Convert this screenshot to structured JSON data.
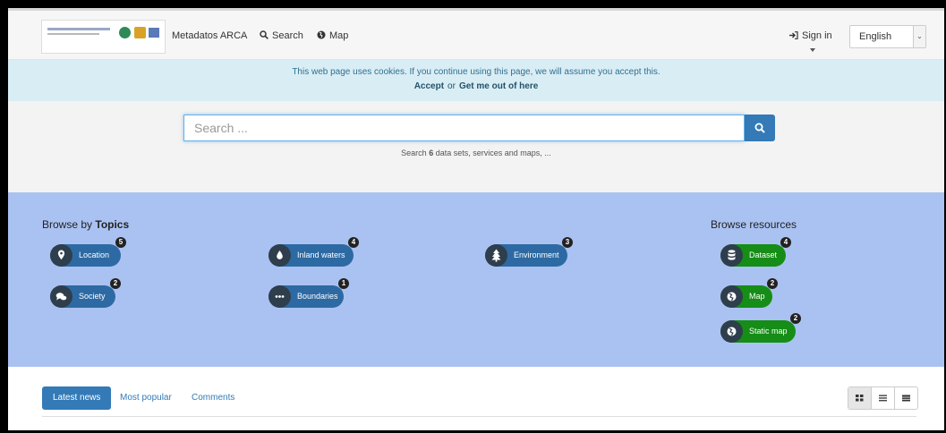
{
  "navbar": {
    "brand": "Metadatos ARCA",
    "search_label": "Search",
    "map_label": "Map",
    "signin_label": "Sign in",
    "language": "English"
  },
  "cookie": {
    "message": "This web page uses cookies. If you continue using this page, we will assume you accept this.",
    "accept_label": "Accept",
    "or_label": "or",
    "decline_label": "Get me out of here"
  },
  "search": {
    "placeholder": "Search ...",
    "hint_prefix": "Search",
    "hint_count": "6",
    "hint_suffix": "data sets, services and maps, ..."
  },
  "topics": {
    "title_prefix": "Browse by",
    "title_strong": "Topics",
    "items": [
      {
        "label": "Location",
        "count": "5",
        "icon": "location-pin-icon"
      },
      {
        "label": "Inland waters",
        "count": "4",
        "icon": "water-drop-icon"
      },
      {
        "label": "Environment",
        "count": "3",
        "icon": "tree-icon"
      },
      {
        "label": "Society",
        "count": "2",
        "icon": "speech-bubbles-icon"
      },
      {
        "label": "Boundaries",
        "count": "1",
        "icon": "ellipsis-icon"
      }
    ]
  },
  "resources": {
    "title": "Browse resources",
    "items": [
      {
        "label": "Dataset",
        "count": "4",
        "icon": "database-icon"
      },
      {
        "label": "Map",
        "count": "2",
        "icon": "globe-icon"
      },
      {
        "label": "Static map",
        "count": "2",
        "icon": "globe-icon"
      }
    ]
  },
  "tabs": {
    "latest": "Latest news",
    "popular": "Most popular",
    "comments": "Comments"
  },
  "colors": {
    "primary": "#337ab7",
    "topic_pill": "#2d6aa3",
    "resource_pill": "#158d17",
    "browse_bg": "#aac2f2",
    "cookie_bg": "#d9edf5"
  }
}
